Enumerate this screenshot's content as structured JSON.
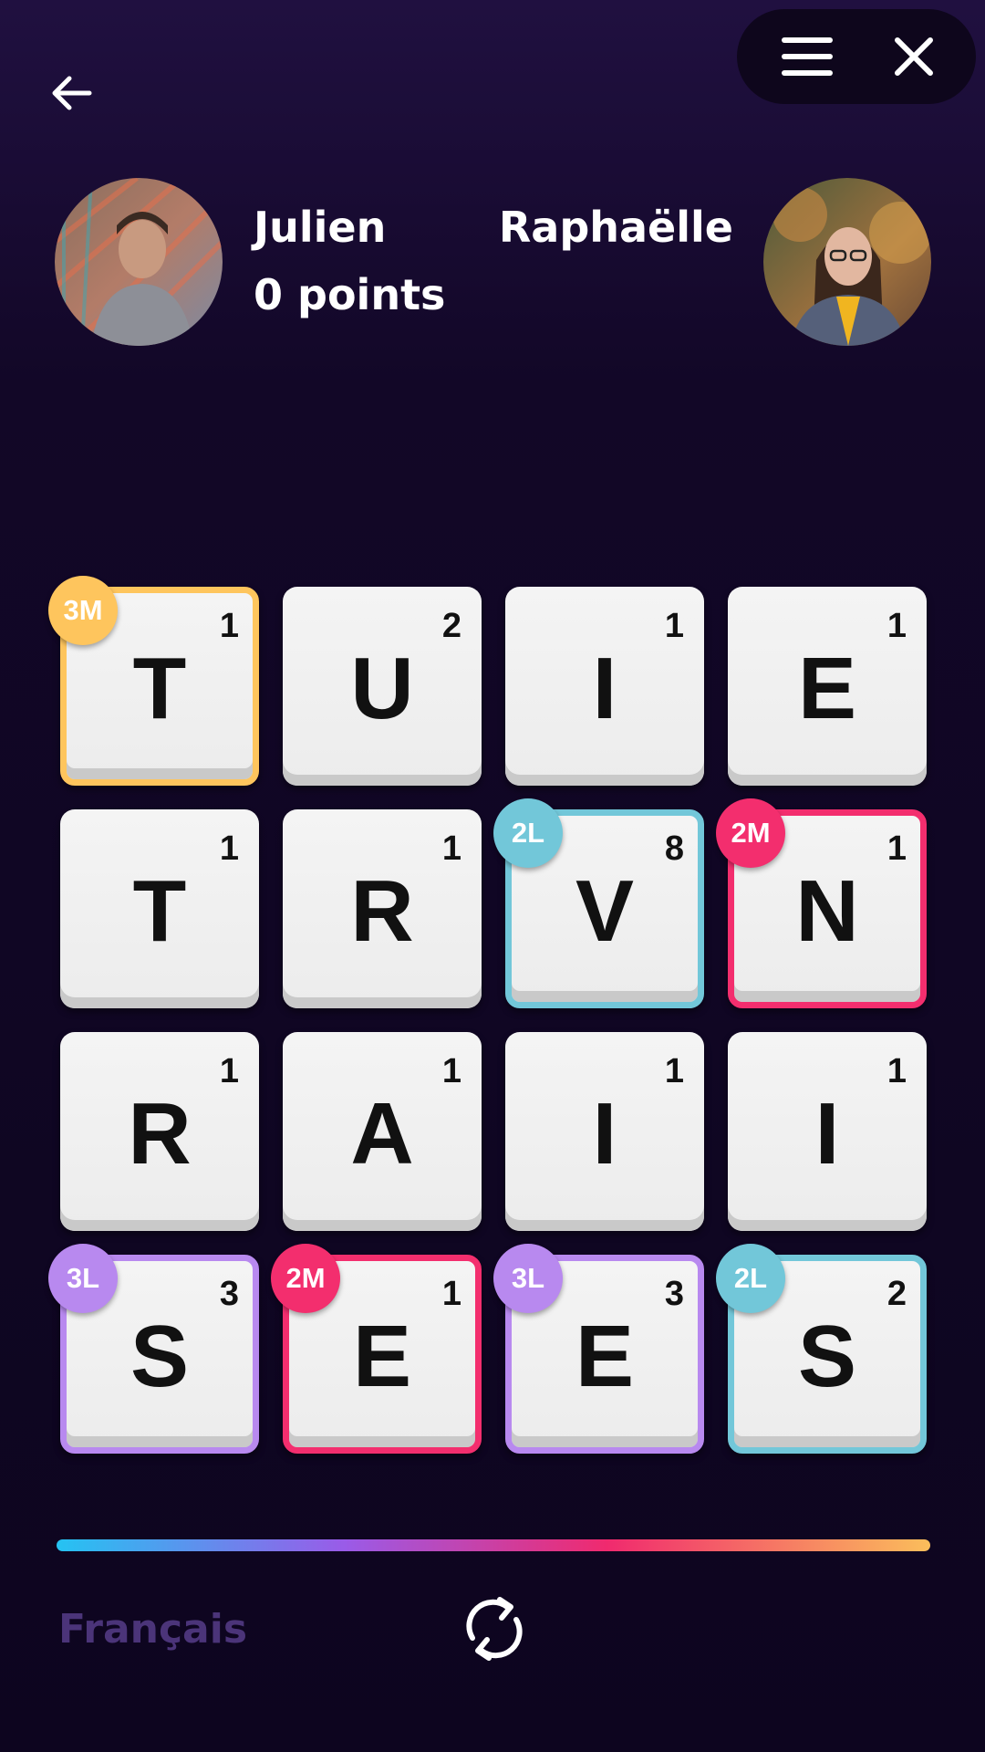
{
  "players": [
    {
      "name": "Julien",
      "points": "0 points"
    },
    {
      "name": "Raphaëlle"
    }
  ],
  "board": {
    "tiles": [
      {
        "letter": "T",
        "value": "1",
        "bonus": "3M",
        "color": "#fec55d"
      },
      {
        "letter": "U",
        "value": "2",
        "bonus": "",
        "color": ""
      },
      {
        "letter": "I",
        "value": "1",
        "bonus": "",
        "color": ""
      },
      {
        "letter": "E",
        "value": "1",
        "bonus": "",
        "color": ""
      },
      {
        "letter": "T",
        "value": "1",
        "bonus": "",
        "color": ""
      },
      {
        "letter": "R",
        "value": "1",
        "bonus": "",
        "color": ""
      },
      {
        "letter": "V",
        "value": "8",
        "bonus": "2L",
        "color": "#72c7d9"
      },
      {
        "letter": "N",
        "value": "1",
        "bonus": "2M",
        "color": "#f32e6e"
      },
      {
        "letter": "R",
        "value": "1",
        "bonus": "",
        "color": ""
      },
      {
        "letter": "A",
        "value": "1",
        "bonus": "",
        "color": ""
      },
      {
        "letter": "I",
        "value": "1",
        "bonus": "",
        "color": ""
      },
      {
        "letter": "I",
        "value": "1",
        "bonus": "",
        "color": ""
      },
      {
        "letter": "S",
        "value": "3",
        "bonus": "3L",
        "color": "#b889ef"
      },
      {
        "letter": "E",
        "value": "1",
        "bonus": "2M",
        "color": "#f32e6e"
      },
      {
        "letter": "E",
        "value": "3",
        "bonus": "3L",
        "color": "#b889ef"
      },
      {
        "letter": "S",
        "value": "2",
        "bonus": "2L",
        "color": "#72c7d9"
      }
    ]
  },
  "footer": {
    "language": "Français"
  },
  "icons": {
    "back": "arrow-left-icon",
    "menu": "hamburger-menu-icon",
    "close": "close-icon",
    "shuffle": "shuffle-icon"
  },
  "colors": {
    "background": "#130828",
    "bonus_3M": "#fec55d",
    "bonus_2M": "#f32e6e",
    "bonus_2L": "#72c7d9",
    "bonus_3L": "#b889ef",
    "language_text": "#4b3479"
  }
}
